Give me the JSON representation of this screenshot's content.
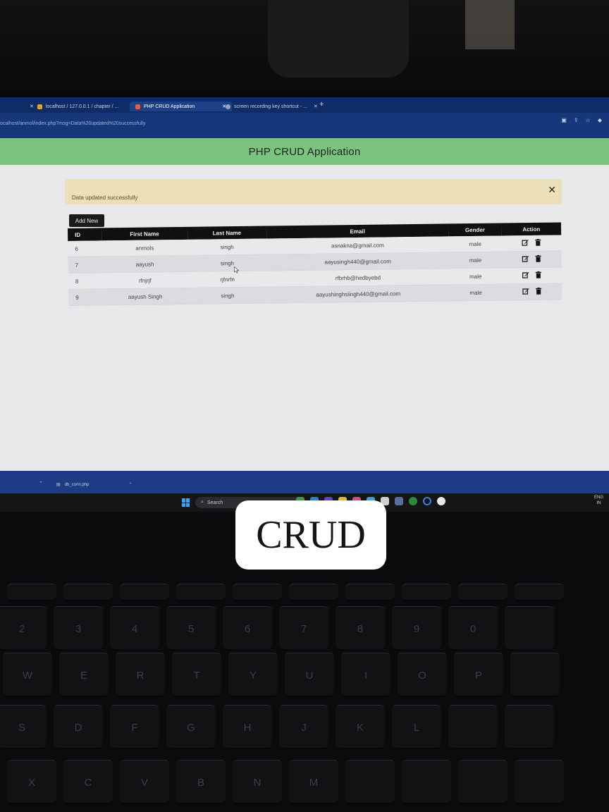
{
  "browser": {
    "tabs": [
      {
        "label": "localhost / 127.0.0.1 / chapter / ...",
        "active": false,
        "favicon_color": "#e4a235"
      },
      {
        "label": "PHP CRUD Application",
        "active": true,
        "favicon_color": "#e2603a"
      },
      {
        "label": "screen recording key shortcut - ...",
        "active": false,
        "favicon_color": "#9aa4b8"
      }
    ],
    "new_tab_symbol": "+",
    "url": "ocalhost/anmol/index.php?msg=Data%20updated%20successfully"
  },
  "app": {
    "title": "PHP CRUD Application",
    "alert": {
      "message": "Data updated successfully",
      "close_symbol": "✕"
    },
    "add_button_label": "Add New",
    "table": {
      "columns": [
        "ID",
        "First Name",
        "Last Name",
        "Email",
        "Gender",
        "Action"
      ],
      "rows": [
        {
          "id": "6",
          "first_name": "anmols",
          "last_name": "singh",
          "email": "asnakna@gmail.com",
          "gender": "male"
        },
        {
          "id": "7",
          "first_name": "aayush",
          "last_name": "singh",
          "email": "aayusingh440@gmail.com",
          "gender": "male"
        },
        {
          "id": "8",
          "first_name": "rfnjrjf",
          "last_name": "rjfnrfn",
          "email": "rfbrhb@hedbyebd",
          "gender": "male"
        },
        {
          "id": "9",
          "first_name": "aayush Singh",
          "last_name": "singh",
          "email": "aayushinghsiingh440@gmail.com",
          "gender": "male"
        }
      ],
      "action_icons": [
        "edit-icon",
        "trash-icon"
      ]
    }
  },
  "downloads": {
    "file_name": "db_conn.php"
  },
  "taskbar": {
    "search_placeholder": "Search",
    "language": "ENG",
    "region": "IN"
  },
  "caption": "CRUD",
  "keyboard": {
    "row_numbers": [
      "2",
      "3",
      "4",
      "5",
      "6",
      "7",
      "8",
      "9",
      "0"
    ],
    "row_qwerty": [
      "W",
      "E",
      "R",
      "T",
      "Y",
      "U",
      "I",
      "O",
      "P"
    ],
    "row_asdf": [
      "S",
      "D",
      "F",
      "G",
      "H",
      "J",
      "K",
      "L"
    ],
    "row_zxcv": [
      "X",
      "C",
      "V",
      "B",
      "N",
      "M"
    ]
  }
}
